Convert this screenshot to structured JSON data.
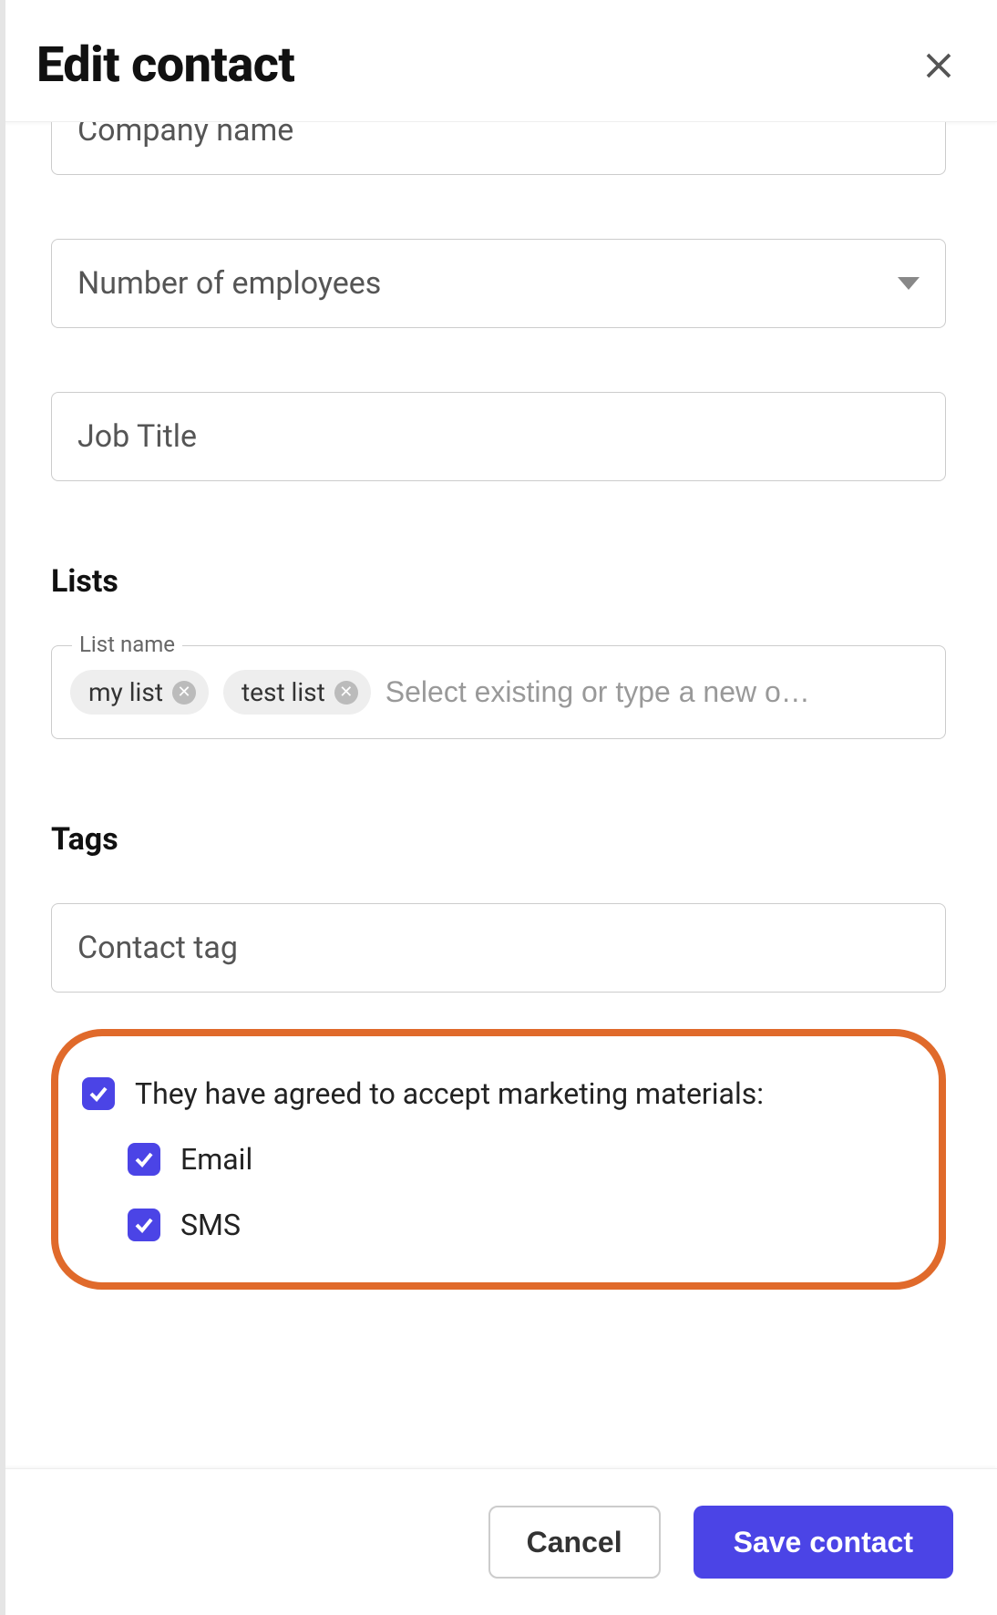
{
  "header": {
    "title": "Edit contact"
  },
  "fields": {
    "company_name_placeholder": "Company name",
    "employees_placeholder": "Number of employees",
    "job_title_placeholder": "Job Title"
  },
  "lists": {
    "heading": "Lists",
    "field_label": "List name",
    "chips": [
      "my list",
      "test list"
    ],
    "input_placeholder": "Select existing or type a new o…"
  },
  "tags": {
    "heading": "Tags",
    "placeholder": "Contact tag"
  },
  "consent": {
    "main_label": "They have agreed to accept marketing materials:",
    "main_checked": true,
    "email_label": "Email",
    "email_checked": true,
    "sms_label": "SMS",
    "sms_checked": true
  },
  "footer": {
    "cancel": "Cancel",
    "save": "Save contact"
  },
  "colors": {
    "accent": "#4b44e6",
    "highlight_border": "#e06a2b"
  }
}
